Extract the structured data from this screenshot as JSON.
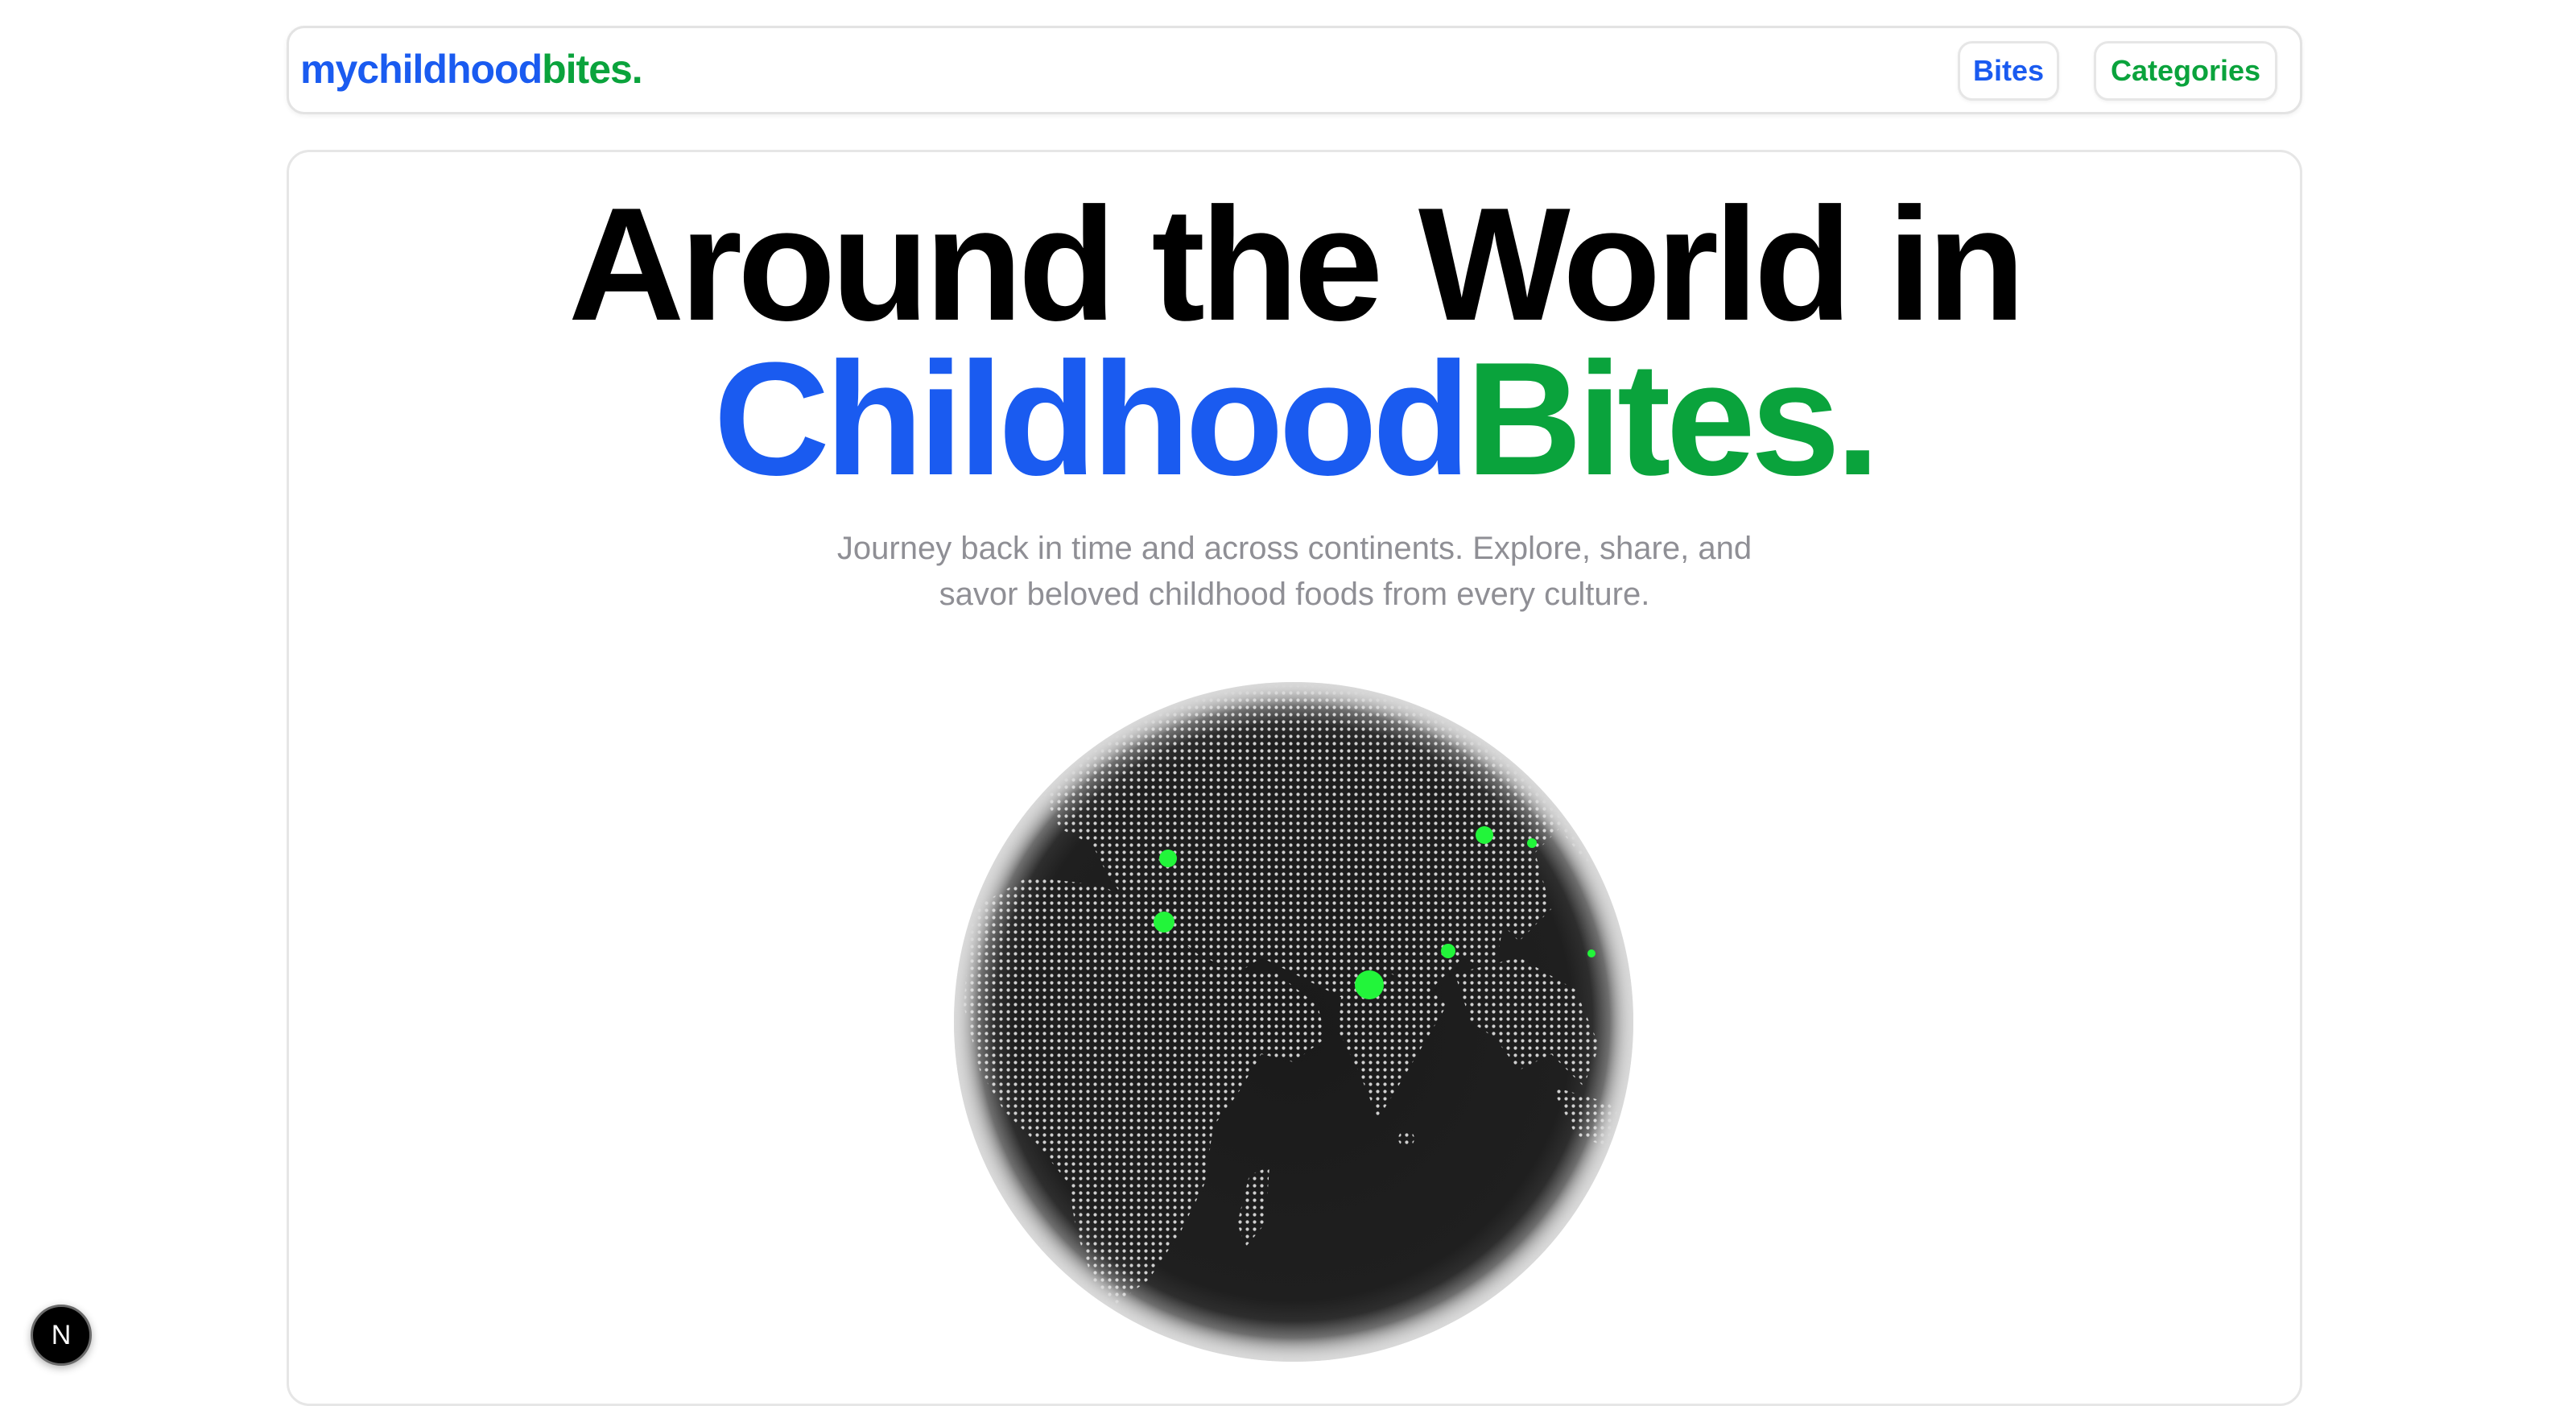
{
  "nav": {
    "logo_part1": "mychildhood",
    "logo_part2": "bites.",
    "links": [
      {
        "label": "Bites"
      },
      {
        "label": "Categories"
      }
    ]
  },
  "hero": {
    "headline_line1": "Around the World in",
    "headline_part_blue": "Childhood",
    "headline_part_green": "Bites.",
    "subtitle_line1": "Journey back in time and across continents. Explore, share, and",
    "subtitle_line2": "savor beloved childhood foods from every culture."
  },
  "globe": {
    "icon": "globe-icon",
    "marker_color": "#22f53a",
    "dot_color": "#cfcfcf",
    "ocean_color": "#1a1a1a"
  },
  "dev_badge": {
    "label": "N"
  },
  "colors": {
    "blue": "#1a5bf0",
    "green": "#0aa33c"
  }
}
